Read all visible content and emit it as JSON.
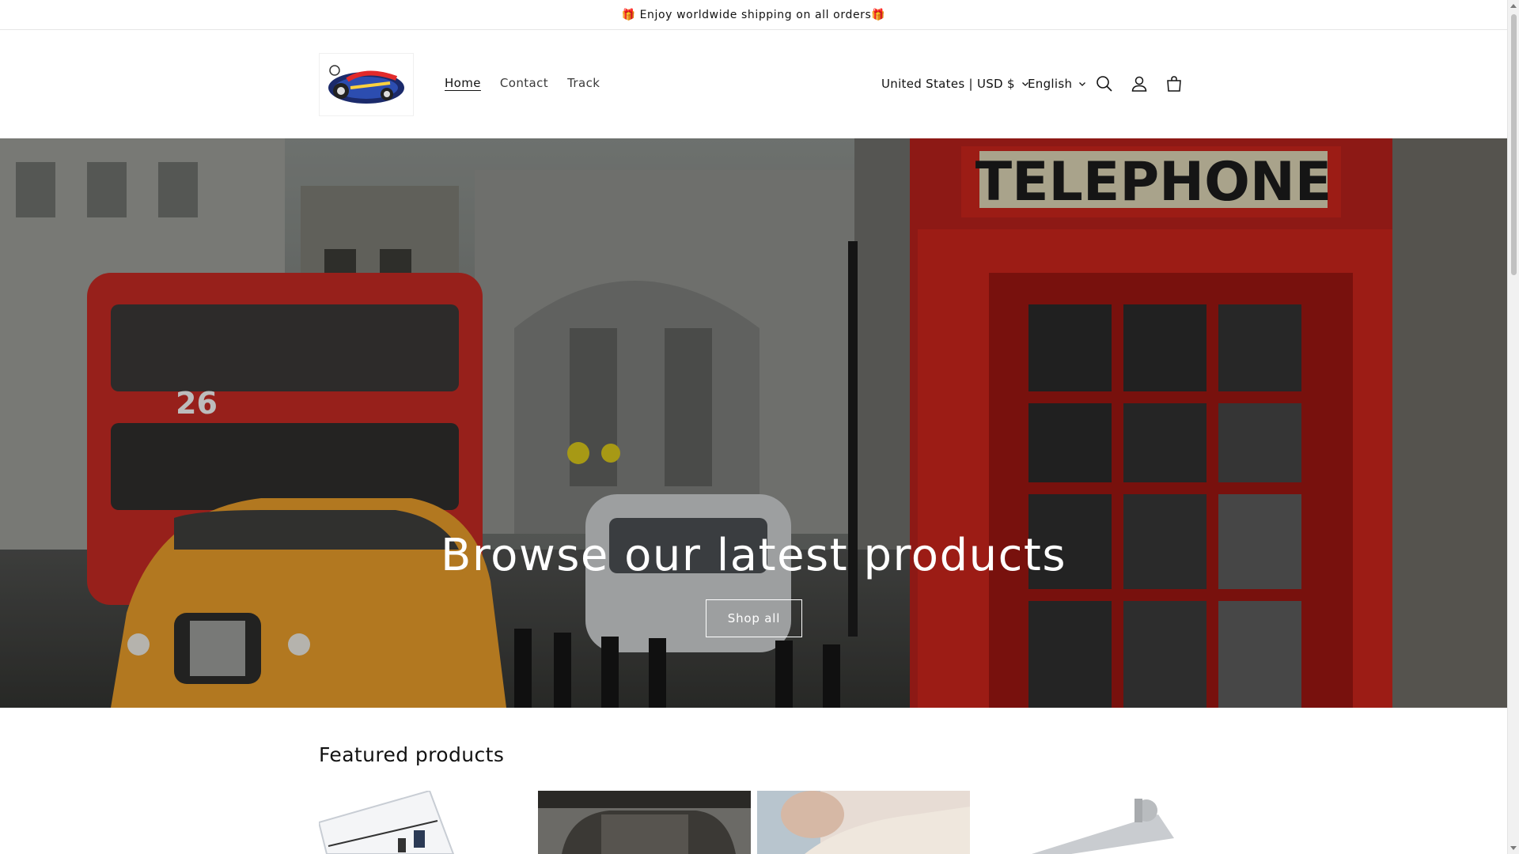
{
  "announcement": {
    "text": "🎁 Enjoy worldwide shipping on all orders🎁",
    "icon": "gift-icon"
  },
  "header": {
    "logo_alt": "Auto Mobile",
    "nav": [
      {
        "label": "Home",
        "active": true
      },
      {
        "label": "Contact",
        "active": false
      },
      {
        "label": "Track",
        "active": false
      }
    ],
    "country_selector": "United States | USD $",
    "language_selector": "English",
    "icons": [
      "search-icon",
      "account-icon",
      "cart-icon"
    ]
  },
  "hero": {
    "title": "Browse our latest products",
    "button_label": "Shop all",
    "sign_text": "TELEPHONE",
    "bus_number": "26"
  },
  "featured": {
    "title": "Featured products",
    "products_visible": 4
  },
  "colors": {
    "text": "#121212",
    "phonebox_red": "#c8241c",
    "bus_red": "#c22a23",
    "taxi_orange": "#e59a2a"
  }
}
